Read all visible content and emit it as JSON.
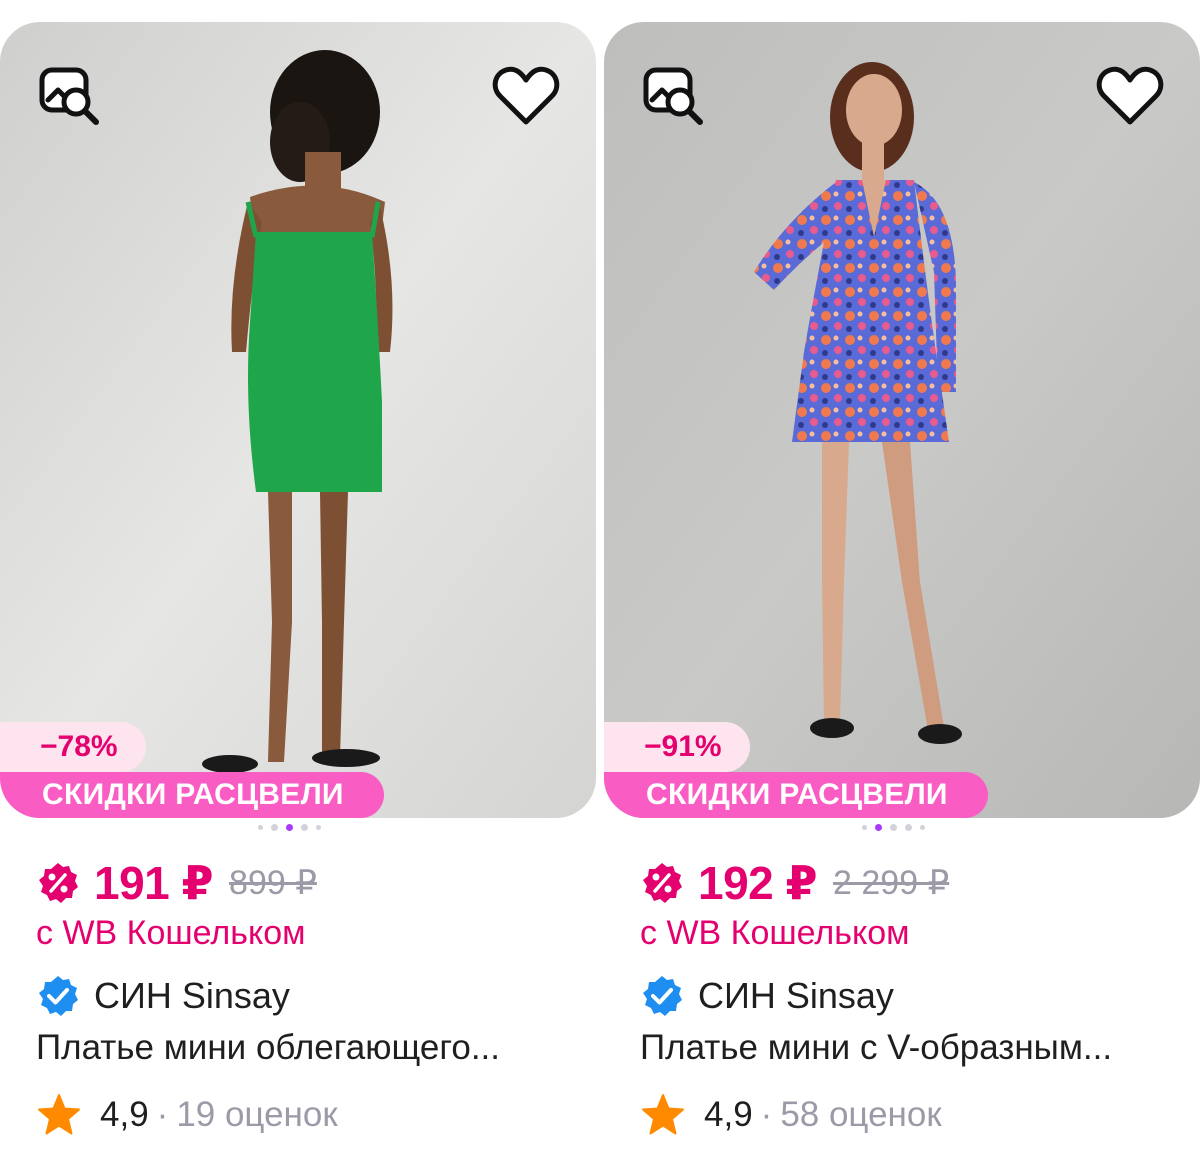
{
  "products": [
    {
      "discount": "−78%",
      "promo_label": "СКИДКИ РАСЦВЕЛИ",
      "price": "191 ₽",
      "old_price": "899 ₽",
      "wallet_note": "с WB Кошельком",
      "brand": "СИН Sinsay",
      "title": "Платье мини облегающего...",
      "rating": "4,9",
      "separator": "·",
      "reviews": "19 оценок",
      "photo_dots_active_index": 2
    },
    {
      "discount": "−91%",
      "promo_label": "СКИДКИ РАСЦВЕЛИ",
      "price": "192 ₽",
      "old_price": "2 299 ₽",
      "wallet_note": "с WB Кошельком",
      "brand": "СИН Sinsay",
      "title": "Платье мини с V-образным...",
      "rating": "4,9",
      "separator": "·",
      "reviews": "58 оценок",
      "photo_dots_active_index": 1
    }
  ],
  "icons": {
    "search": "image-search-icon",
    "favorite": "heart-icon",
    "sale": "sale-percent-icon",
    "verified": "verified-check-icon",
    "rating": "star-icon"
  },
  "colors": {
    "price": "#e4006f",
    "promo_badge": "#f95dc4",
    "discount_badge_bg": "#fde4ef",
    "verified": "#1f8ef1",
    "star": "#ff8a00",
    "muted": "#9d9aa8"
  }
}
